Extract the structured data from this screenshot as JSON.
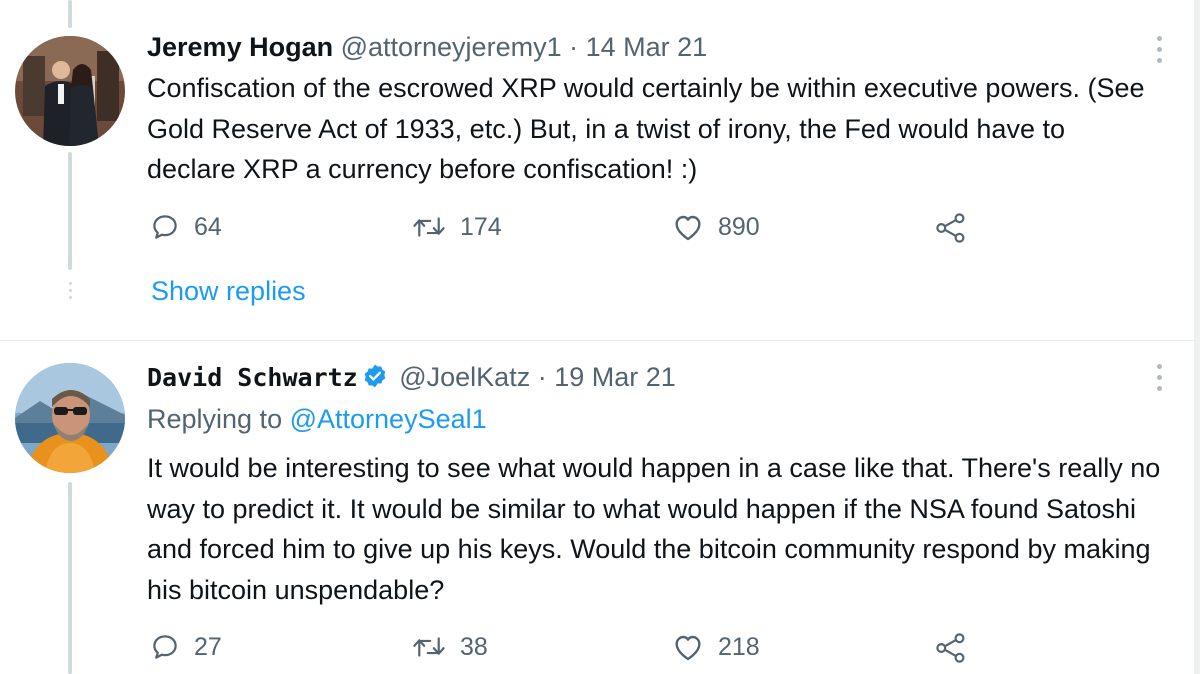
{
  "tweets": [
    {
      "name": "Jeremy Hogan",
      "handle": "@attorneyjeremy1",
      "separator": "·",
      "date": "14 Mar 21",
      "verified": false,
      "replying_to_prefix": "",
      "replying_to_handle": "",
      "text": "Confiscation of the escrowed XRP would certainly be within executive powers.  (See Gold Reserve Act of 1933, etc.) But, in a twist of irony, the Fed would have to declare XRP a currency before confiscation! :)",
      "stats": {
        "replies": "64",
        "retweets": "174",
        "likes": "890"
      },
      "show_replies": "Show replies",
      "avatar_icon": "avatar-couple-photo"
    },
    {
      "name": "David Schwartz",
      "handle": "@JoelKatz",
      "separator": "·",
      "date": "19 Mar 21",
      "verified": true,
      "replying_to_prefix": "Replying to",
      "replying_to_handle": "@AttorneySeal1",
      "text": "It would be interesting to see what would happen in a case like that. There's really no way to predict it. It would be similar to what would happen if the NSA found Satoshi and forced him to give up his keys. Would the bitcoin community respond by making his bitcoin unspendable?",
      "stats": {
        "replies": "27",
        "retweets": "38",
        "likes": "218"
      },
      "avatar_icon": "avatar-man-sunglasses-photo"
    }
  ],
  "colors": {
    "link": "#1d9bf0",
    "muted": "#536471",
    "text": "#0f1419",
    "thread_line": "#cfd9de"
  }
}
